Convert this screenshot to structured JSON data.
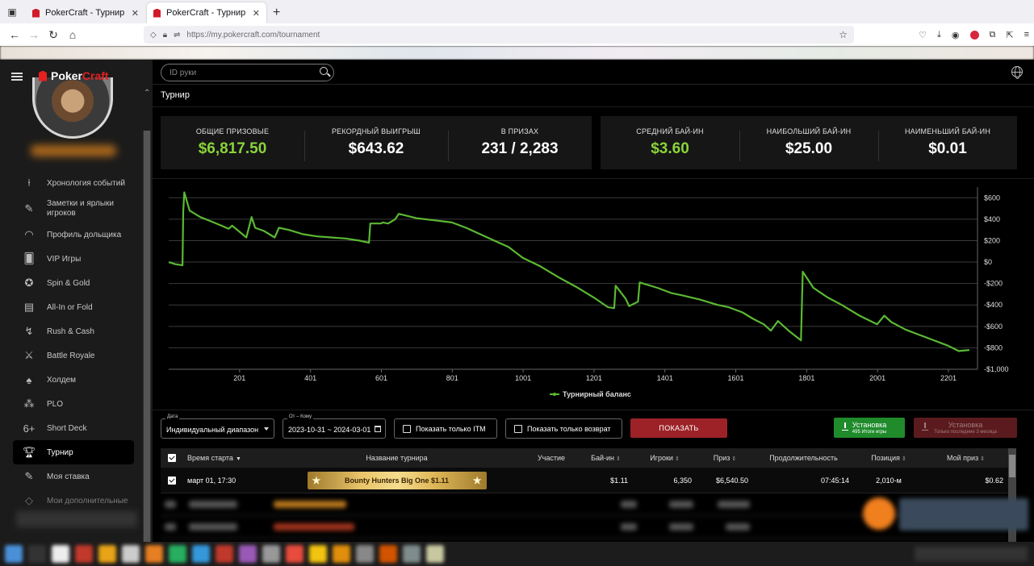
{
  "browser": {
    "tabs": [
      {
        "title": "PokerCraft - Турнир",
        "active": false
      },
      {
        "title": "PokerCraft - Турнир",
        "active": true
      }
    ],
    "url": "https://my.pokercraft.com/tournament"
  },
  "brand": {
    "poker": "Poker",
    "craft": "Craft",
    "accent": "#e52020"
  },
  "sidebar": {
    "items": [
      {
        "label": "Хронология событий",
        "icon": "timeline-icon"
      },
      {
        "label": "Заметки и ярлыки игроков",
        "icon": "notes-icon"
      },
      {
        "label": "Профиль дольщика",
        "icon": "gauge-icon"
      },
      {
        "label": "VIP Игры",
        "icon": "cards-icon"
      },
      {
        "label": "Spin & Gold",
        "icon": "spin-icon"
      },
      {
        "label": "All-In or Fold",
        "icon": "allin-icon"
      },
      {
        "label": "Rush & Cash",
        "icon": "rush-icon"
      },
      {
        "label": "Battle Royale",
        "icon": "swords-icon"
      },
      {
        "label": "Холдем",
        "icon": "holdem-icon"
      },
      {
        "label": "PLO",
        "icon": "plo-icon"
      },
      {
        "label": "Short Deck",
        "icon": "shortdeck-icon"
      },
      {
        "label": "Турнир",
        "icon": "trophy-icon"
      },
      {
        "label": "Моя ставка",
        "icon": "stake-icon"
      },
      {
        "label": "Мои дополнительные",
        "icon": "extra-icon"
      }
    ],
    "active_index": 11
  },
  "search": {
    "placeholder": "ID руки"
  },
  "page_title": "Турнир",
  "stats_left": [
    {
      "label": "ОБЩИЕ ПРИЗОВЫЕ",
      "value": "$6,817.50",
      "green": true
    },
    {
      "label": "РЕКОРДНЫЙ ВЫИГРЫШ",
      "value": "$643.62",
      "green": false
    },
    {
      "label": "В ПРИЗАХ",
      "value": "231 / 2,283",
      "green": false
    }
  ],
  "stats_right": [
    {
      "label": "СРЕДНИЙ БАЙ-ИН",
      "value": "$3.60",
      "green": true
    },
    {
      "label": "НАИБОЛЬШИЙ БАЙ-ИН",
      "value": "$25.00",
      "green": false
    },
    {
      "label": "НАИМЕНЬШИЙ БАЙ-ИН",
      "value": "$0.01",
      "green": false
    }
  ],
  "chart_data": {
    "type": "line",
    "series": [
      {
        "name": "Турнирный баланс",
        "color": "#5bb833",
        "points": [
          [
            1,
            0
          ],
          [
            20,
            -20
          ],
          [
            40,
            -30
          ],
          [
            42,
            470
          ],
          [
            45,
            650
          ],
          [
            60,
            480
          ],
          [
            90,
            420
          ],
          [
            120,
            380
          ],
          [
            150,
            340
          ],
          [
            170,
            310
          ],
          [
            180,
            340
          ],
          [
            220,
            230
          ],
          [
            235,
            420
          ],
          [
            245,
            320
          ],
          [
            270,
            290
          ],
          [
            300,
            230
          ],
          [
            312,
            320
          ],
          [
            340,
            300
          ],
          [
            380,
            260
          ],
          [
            420,
            240
          ],
          [
            460,
            230
          ],
          [
            500,
            220
          ],
          [
            540,
            200
          ],
          [
            566,
            180
          ],
          [
            570,
            360
          ],
          [
            600,
            360
          ],
          [
            605,
            370
          ],
          [
            620,
            360
          ],
          [
            640,
            400
          ],
          [
            650,
            450
          ],
          [
            700,
            410
          ],
          [
            750,
            390
          ],
          [
            800,
            370
          ],
          [
            840,
            320
          ],
          [
            880,
            260
          ],
          [
            920,
            200
          ],
          [
            960,
            140
          ],
          [
            1000,
            40
          ],
          [
            1050,
            -40
          ],
          [
            1100,
            -140
          ],
          [
            1150,
            -230
          ],
          [
            1200,
            -330
          ],
          [
            1240,
            -420
          ],
          [
            1258,
            -430
          ],
          [
            1262,
            -220
          ],
          [
            1290,
            -340
          ],
          [
            1300,
            -410
          ],
          [
            1325,
            -370
          ],
          [
            1330,
            -190
          ],
          [
            1380,
            -240
          ],
          [
            1420,
            -290
          ],
          [
            1450,
            -310
          ],
          [
            1500,
            -350
          ],
          [
            1550,
            -400
          ],
          [
            1580,
            -420
          ],
          [
            1620,
            -470
          ],
          [
            1650,
            -530
          ],
          [
            1680,
            -580
          ],
          [
            1700,
            -640
          ],
          [
            1720,
            -550
          ],
          [
            1750,
            -640
          ],
          [
            1785,
            -730
          ],
          [
            1790,
            -90
          ],
          [
            1820,
            -240
          ],
          [
            1860,
            -330
          ],
          [
            1900,
            -400
          ],
          [
            1950,
            -500
          ],
          [
            2000,
            -580
          ],
          [
            2020,
            -500
          ],
          [
            2040,
            -560
          ],
          [
            2080,
            -630
          ],
          [
            2120,
            -680
          ],
          [
            2160,
            -730
          ],
          [
            2200,
            -780
          ],
          [
            2230,
            -830
          ],
          [
            2260,
            -820
          ]
        ]
      }
    ],
    "x_ticks": [
      201,
      401,
      601,
      801,
      1001,
      1201,
      1401,
      1601,
      1801,
      2001,
      2201
    ],
    "y_ticks": [
      "$600",
      "$400",
      "$200",
      "$0",
      "-$200",
      "-$400",
      "-$600",
      "-$800",
      "-$1,000"
    ],
    "y_tick_values": [
      600,
      400,
      200,
      0,
      -200,
      -400,
      -600,
      -800,
      -1000
    ],
    "xlim": [
      1,
      2283
    ],
    "ylim": [
      -1000,
      700
    ],
    "grid": true,
    "legend_placement": "bottom-center",
    "legend_label": "Турнирный баланс"
  },
  "filters": {
    "date_label": "Дата",
    "date_value": "Индивидуальный диапазон",
    "range_label": "От – Кому",
    "range_value": "2023-10-31 ~ 2024-03-01",
    "itm_label": "Показать только ITM",
    "refund_label": "Показать только возврат",
    "show_button": "ПОКАЗАТЬ",
    "download_label": "Установка",
    "download_sub": "495 Итоги игры",
    "download2_label": "Установка",
    "download2_sub": "Только последние 3 месяца"
  },
  "table": {
    "headers": {
      "start": "Время старта",
      "name": "Название турнира",
      "entry": "Участие",
      "buyin": "Бай-ин",
      "players": "Игроки",
      "prize": "Приз",
      "duration": "Продолжительность",
      "position": "Позиция",
      "my_prize": "Мой приз"
    },
    "rows": [
      {
        "start": "март 01, 17:30",
        "name": "Bounty Hunters Big One $1.11",
        "entry": "",
        "buyin": "$1.11",
        "players": "6,350",
        "prize": "$6,540.50",
        "duration": "07:45:14",
        "position": "2,010-м",
        "my_prize": "$0.62"
      }
    ]
  }
}
